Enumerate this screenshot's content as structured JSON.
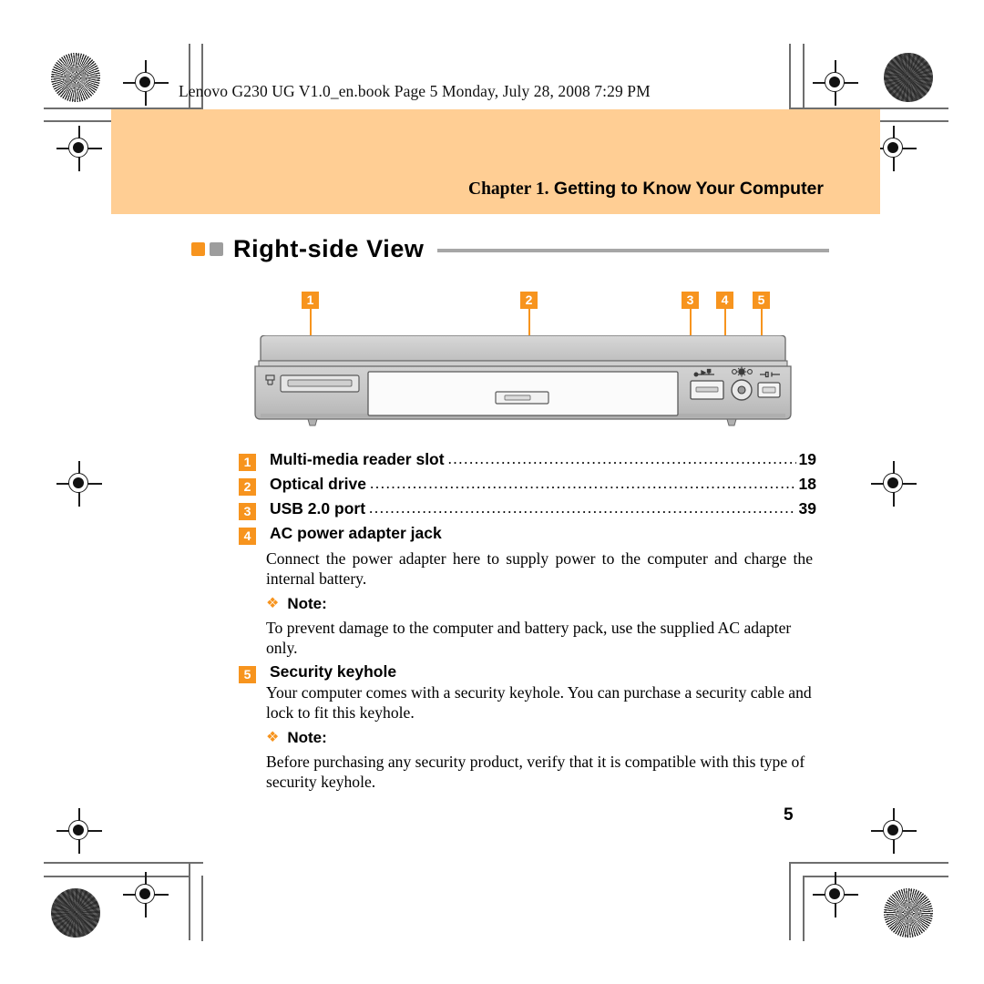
{
  "header": {
    "file_line": "Lenovo G230 UG V1.0_en.book  Page 5  Monday, July 28, 2008  7:29 PM"
  },
  "chapter": {
    "number_text": "Chapter 1.",
    "title_text": " Getting to Know Your Computer",
    "band_color": "#FFCE94"
  },
  "section": {
    "title": "Right-side View",
    "marker_primary_color": "#F7941E",
    "marker_secondary_color": "#9d9d9d",
    "rule_color": "#a6a6a6"
  },
  "callouts": [
    {
      "num": "1"
    },
    {
      "num": "2"
    },
    {
      "num": "3"
    },
    {
      "num": "4"
    },
    {
      "num": "5"
    }
  ],
  "items": [
    {
      "num": "1",
      "label": "Multi-media reader slot",
      "page": "19",
      "has_leader": true
    },
    {
      "num": "2",
      "label": "Optical drive",
      "page": "18",
      "has_leader": true
    },
    {
      "num": "3",
      "label": "USB 2.0 port",
      "page": "39",
      "has_leader": true
    },
    {
      "num": "4",
      "label": "AC power adapter jack",
      "page": "",
      "has_leader": false
    }
  ],
  "item4": {
    "body": "Connect the power adapter here to supply power to the computer and charge the internal battery.",
    "note_bullet": "❖",
    "note_label": "Note:",
    "note_body": "To prevent damage to the computer and battery pack, use the supplied AC adapter only."
  },
  "item5": {
    "num": "5",
    "heading": "Security keyhole",
    "body": "Your computer comes with a security keyhole. You can purchase a security cable and lock to fit this keyhole.",
    "note_bullet": "❖",
    "note_label": "Note:",
    "note_body": "Before purchasing any security product, verify that it is compatible with this type of security keyhole."
  },
  "footer": {
    "page_number": "5"
  },
  "dot_leader": "......................................................................................................"
}
